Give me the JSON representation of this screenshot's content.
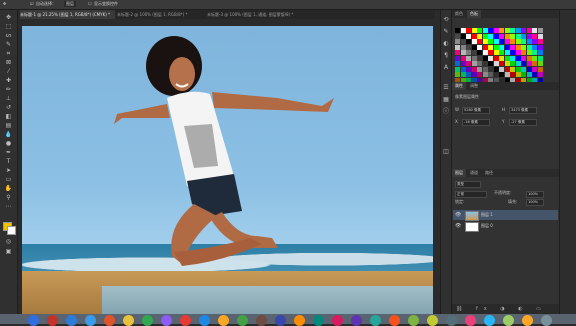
{
  "options_bar": {
    "auto_select_label": "自动选择：",
    "auto_select_value": "图层",
    "show_transform_label": "显示变换控件"
  },
  "tabs": [
    {
      "label": "未标题-1 @ 21.25% (图层 1, RGB/8*) (CMYK) *",
      "active": true
    },
    {
      "label": "未标题-2 @ 100% (图层 1, RGB/8*) *",
      "active": false
    },
    {
      "label": "未标题-3 @ 100% (图层 1, 通道, 图层蒙版/8) *",
      "active": false
    }
  ],
  "panels": {
    "top_tabs": [
      "颜色",
      "色板"
    ],
    "properties_tabs": [
      "属性",
      "调整"
    ],
    "properties_subtitle": "像素图层属性",
    "transform": {
      "w_label": "W",
      "w_value": "5280 像素",
      "h_label": "H",
      "h_value": "3473 像素",
      "x_label": "X",
      "x_value": "-16 像素",
      "y_label": "Y",
      "y_value": "-27 像素"
    },
    "layers_tabs": [
      "图层",
      "通道",
      "路径"
    ],
    "kind_filter": "类型",
    "blend_mode": "正常",
    "opacity_label": "不透明度:",
    "opacity_value": "100%",
    "lock_label": "锁定:",
    "fill_label": "填充:",
    "fill_value": "100%",
    "layers": [
      {
        "name": "图层 1",
        "selected": true
      },
      {
        "name": "图层 0",
        "selected": false
      }
    ]
  },
  "swatch_colors": [
    "#000000",
    "#ffffff",
    "#ff0000",
    "#ffff00",
    "#00ff00",
    "#00ffff",
    "#0000ff",
    "#ff00ff",
    "#ff8000",
    "#80ff00",
    "#00ff80",
    "#0080ff",
    "#8000ff",
    "#ff0080",
    "#c0c0c0",
    "#808080",
    "#404040"
  ],
  "dock_colors": [
    "#2f6de0",
    "#c2342b",
    "#2e7bd8",
    "#3b9be8",
    "#e0542b",
    "#e8c23a",
    "#33a853",
    "#8b5cf6",
    "#e53935",
    "#1e88e5",
    "#f9a825",
    "#43a047",
    "#6d4c41",
    "#3949ab",
    "#fb8c00",
    "#00897b",
    "#d81b60",
    "#5e35b1",
    "#26a69a",
    "#f4511e",
    "#7cb342",
    "#c0ca33",
    "#546e7a",
    "#ec407a",
    "#29b6f6",
    "#9ccc65",
    "#ffa726",
    "#78909c"
  ]
}
